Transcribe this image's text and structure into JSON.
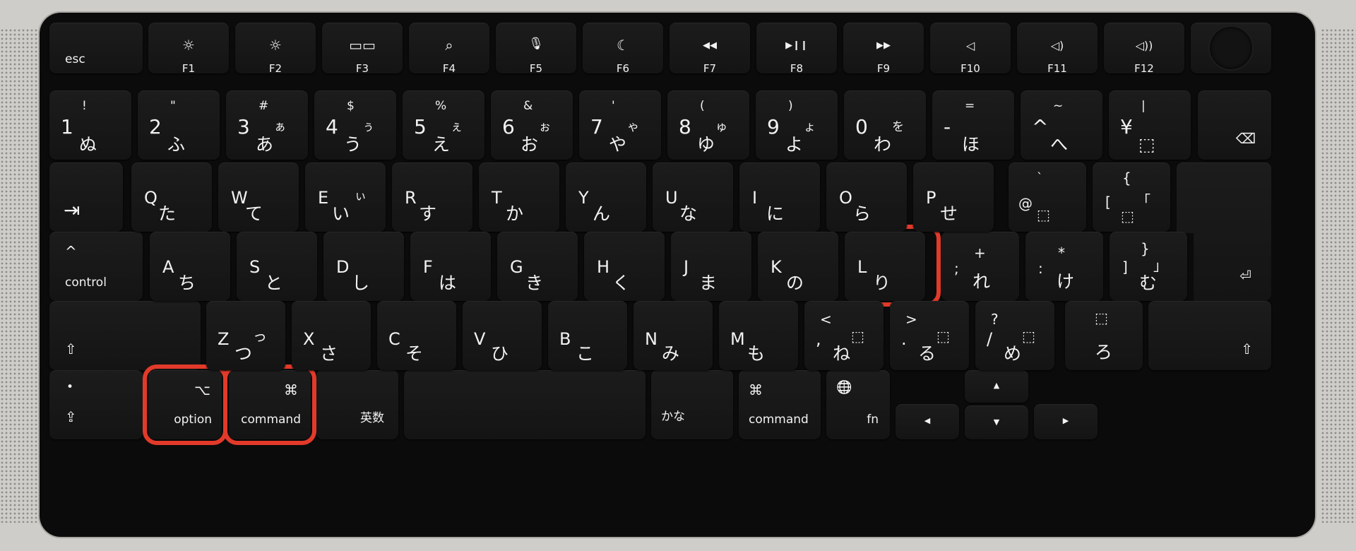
{
  "keyboard": {
    "frow": {
      "esc": "esc",
      "f1_icon": "☼",
      "f1": "F1",
      "f2_icon": "☼",
      "f2": "F2",
      "f3_icon": "▭▭",
      "f3": "F3",
      "f4_icon": "⌕",
      "f4": "F4",
      "f5_icon": "🎙",
      "f5": "F5",
      "f6_icon": "☾",
      "f6": "F6",
      "f7_icon": "◀◀",
      "f7": "F7",
      "f8_icon": "▶❙❙",
      "f8": "F8",
      "f9_icon": "▶▶",
      "f9": "F9",
      "f10_icon": "◁",
      "f10": "F10",
      "f11_icon": "◁)",
      "f11": "F11",
      "f12_icon": "◁))",
      "f12": "F12"
    },
    "numrow": [
      {
        "upper": "!",
        "main": "1",
        "kana_small": "",
        "kana": "ぬ"
      },
      {
        "upper": "\"",
        "main": "2",
        "kana_small": "",
        "kana": "ふ"
      },
      {
        "upper": "#",
        "main": "3",
        "kana_small": "ぁ",
        "kana": "あ"
      },
      {
        "upper": "$",
        "main": "4",
        "kana_small": "ぅ",
        "kana": "う"
      },
      {
        "upper": "%",
        "main": "5",
        "kana_small": "ぇ",
        "kana": "え"
      },
      {
        "upper": "&",
        "main": "6",
        "kana_small": "ぉ",
        "kana": "お"
      },
      {
        "upper": "'",
        "main": "7",
        "kana_small": "ゃ",
        "kana": "や"
      },
      {
        "upper": "(",
        "main": "8",
        "kana_small": "ゅ",
        "kana": "ゆ"
      },
      {
        "upper": ")",
        "main": "9",
        "kana_small": "ょ",
        "kana": "よ"
      },
      {
        "upper": "",
        "main": "0",
        "kana_small": "を",
        "kana": "わ"
      },
      {
        "upper": "=",
        "main": "-",
        "kana_small": "",
        "kana": "ほ"
      },
      {
        "upper": "~",
        "main": "^",
        "kana_small": "",
        "kana": "へ"
      },
      {
        "upper": "|",
        "main": "¥",
        "kana_small": "",
        "kana": "⬚"
      }
    ],
    "delete_icon": "⌫",
    "qrow": [
      {
        "main": "Q",
        "kana_small": "",
        "kana": "た"
      },
      {
        "main": "W",
        "kana_small": "",
        "kana": "て"
      },
      {
        "main": "E",
        "kana_small": "ぃ",
        "kana": "い"
      },
      {
        "main": "R",
        "kana_small": "",
        "kana": "す"
      },
      {
        "main": "T",
        "kana_small": "",
        "kana": "か"
      },
      {
        "main": "Y",
        "kana_small": "",
        "kana": "ん"
      },
      {
        "main": "U",
        "kana_small": "",
        "kana": "な"
      },
      {
        "main": "I",
        "kana_small": "",
        "kana": "に"
      },
      {
        "main": "O",
        "kana_small": "",
        "kana": "ら"
      },
      {
        "main": "P",
        "kana_small": "",
        "kana": "せ"
      }
    ],
    "tab_icon": "⇥",
    "at_key": {
      "upper": "`",
      "main": "@",
      "kana": "⬚"
    },
    "bracket_key": {
      "upper": "{",
      "main": "[",
      "kana_small": "「",
      "kana": "⬚"
    },
    "arow": [
      {
        "main": "A",
        "kana": "ち"
      },
      {
        "main": "S",
        "kana": "と"
      },
      {
        "main": "D",
        "kana": "し"
      },
      {
        "main": "F",
        "kana": "は"
      },
      {
        "main": "G",
        "kana": "き"
      },
      {
        "main": "H",
        "kana": "く"
      },
      {
        "main": "J",
        "kana": "ま"
      },
      {
        "main": "K",
        "kana": "の"
      },
      {
        "main": "L",
        "kana": "り"
      }
    ],
    "semicolon_key": {
      "upper": "+",
      "main": ";",
      "kana": "れ"
    },
    "colon_key": {
      "upper": "*",
      "main": ":",
      "kana": "け"
    },
    "rbracket_key": {
      "upper": "}",
      "main": "]",
      "kana_small": "」",
      "kana": "む"
    },
    "control": {
      "icon": "^",
      "label": "control"
    },
    "return_icon": "⏎",
    "zrow": [
      {
        "upper": "",
        "main": "Z",
        "kana_small": "っ",
        "kana": "つ"
      },
      {
        "upper": "",
        "main": "X",
        "kana_small": "",
        "kana": "さ"
      },
      {
        "upper": "",
        "main": "C",
        "kana_small": "",
        "kana": "そ"
      },
      {
        "upper": "",
        "main": "V",
        "kana_small": "",
        "kana": "ひ"
      },
      {
        "upper": "",
        "main": "B",
        "kana_small": "",
        "kana": "こ"
      },
      {
        "upper": "",
        "main": "N",
        "kana_small": "",
        "kana": "み"
      },
      {
        "upper": "",
        "main": "M",
        "kana_small": "",
        "kana": "も"
      },
      {
        "upper": "<",
        "main": ",",
        "kana_small": "⬚",
        "kana": "ね"
      },
      {
        "upper": ">",
        "main": ".",
        "kana_small": "⬚",
        "kana": "る"
      },
      {
        "upper": "?",
        "main": "/",
        "kana_small": "⬚",
        "kana": "め"
      }
    ],
    "ro_key": {
      "upper": "⬚",
      "kana": "ろ"
    },
    "shift_icon": "⇧",
    "bottom": {
      "fn_globe_dot": "•",
      "fn_globe_icon": "⇪",
      "option_icon": "⌥",
      "option_label": "option",
      "command_icon": "⌘",
      "command_label": "command",
      "eisu": "英数",
      "kana": "かな",
      "command_r_icon": "⌘",
      "command_r_label": "command",
      "globe_icon": "🌐",
      "fn_label": "fn",
      "arrow_up": "▲",
      "arrow_down": "▼",
      "arrow_left": "◀",
      "arrow_right": "▶"
    }
  },
  "highlights": [
    "L",
    "option",
    "command"
  ],
  "colors": {
    "highlight": "#e23a2a",
    "key": "#161616",
    "legend": "#f2f2f2"
  }
}
